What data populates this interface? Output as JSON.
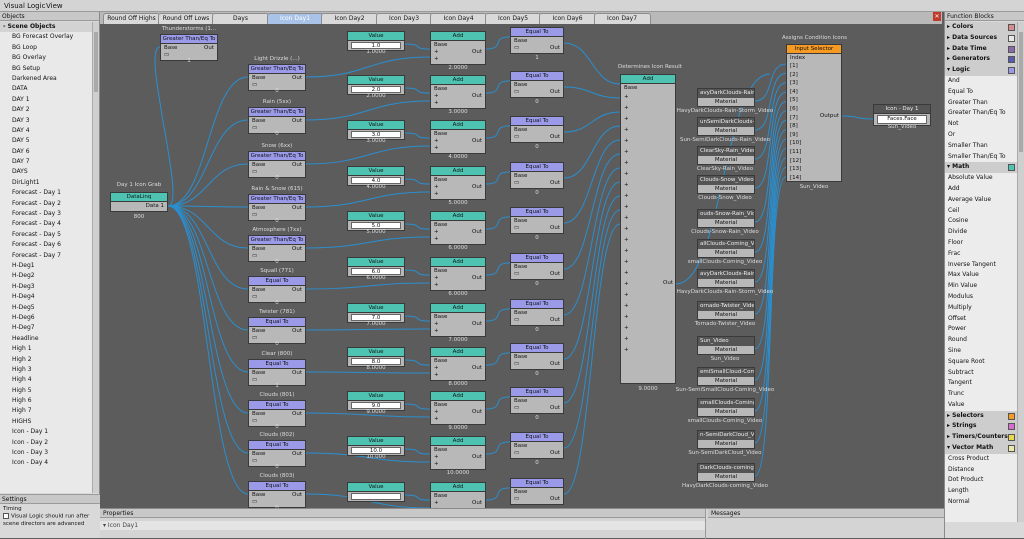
{
  "menu": {
    "title": "Visual Logic",
    "items": [
      "View"
    ]
  },
  "objects_panel": {
    "title": "Objects",
    "category": "- Scene Objects",
    "items": [
      "BG Forecast Overlay",
      "BG Loop",
      "BG Overlay",
      "BG Setup",
      "Darkened Area",
      "DATA",
      "DAY 1",
      "DAY 2",
      "DAY 3",
      "DAY 4",
      "DAY 5",
      "DAY 6",
      "DAY 7",
      "DAYS",
      "DirLight1",
      "Forecast - Day 1",
      "Forecast - Day 2",
      "Forecast - Day 3",
      "Forecast - Day 4",
      "Forecast - Day 5",
      "Forecast - Day 6",
      "Forecast - Day 7",
      "H-Deg1",
      "H-Deg2",
      "H-Deg3",
      "H-Deg4",
      "H-Deg5",
      "H-Deg6",
      "H-Deg7",
      "Headline",
      "High 1",
      "High 2",
      "High 3",
      "High 4",
      "High 5",
      "High 6",
      "High 7",
      "HIGHS",
      "Icon - Day 1",
      "Icon - Day 2",
      "Icon - Day 3",
      "Icon - Day 4"
    ]
  },
  "settings_panel": {
    "title": "Settings",
    "group": "Timing",
    "checkbox_label": "Visual Logic should run after scene directors are advanced"
  },
  "tabs": {
    "items": [
      "Round Off Highs",
      "Round Off Lows",
      "Days",
      "Icon Day1",
      "Icon Day2",
      "Icon Day3",
      "Icon Day4",
      "Icon Day5",
      "Icon Day6",
      "Icon Day7"
    ],
    "active": 3
  },
  "graph": {
    "source": {
      "label": "Day 1 Icon Grab",
      "title": "DataLinq",
      "port": "Data 1",
      "value": "800"
    },
    "gt_nodes": [
      {
        "label": "Thunderstorms (1...",
        "title": "Greater Than/Eq To",
        "value": "1"
      },
      {
        "label": "Light Drizzle (...)",
        "title": "Greater Than/Eq To",
        "value": "0"
      },
      {
        "label": "Rain (5xx)",
        "title": "Greater Than/Eq To",
        "value": "0"
      },
      {
        "label": "Snow (6xx)",
        "title": "Greater Than/Eq To",
        "value": "0"
      },
      {
        "label": "Rain & Snow (615)",
        "title": "Greater Than/Eq To",
        "value": "0"
      },
      {
        "label": "Atmosphere (7xx)",
        "title": "Greater Than/Eq To",
        "value": "0"
      }
    ],
    "eq_nodes": [
      {
        "label": "Squall (771)",
        "title": "Equal To",
        "value": "0"
      },
      {
        "label": "Twister (781)",
        "title": "Equal To",
        "value": "0"
      },
      {
        "label": "Clear (800)",
        "title": "Equal To",
        "value": "1"
      },
      {
        "label": "Clouds (801)",
        "title": "Equal To",
        "value": "0"
      },
      {
        "label": "Clouds (802)",
        "title": "Equal To",
        "value": "0"
      },
      {
        "label": "Clouds (803)",
        "title": "Equal To",
        "value": "0"
      }
    ],
    "values": [
      {
        "title": "Value",
        "field": "1.0",
        "out": "1.0000"
      },
      {
        "title": "Value",
        "field": "2.0",
        "out": "2.0000"
      },
      {
        "title": "Value",
        "field": "3.0",
        "out": "3.0000"
      },
      {
        "title": "Value",
        "field": "4.0",
        "out": "4.0000"
      },
      {
        "title": "Value",
        "field": "5.0",
        "out": "5.0000"
      },
      {
        "title": "Value",
        "field": "6.0",
        "out": "6.0000"
      },
      {
        "title": "Value",
        "field": "7.0",
        "out": "7.0000"
      },
      {
        "title": "Value",
        "field": "8.0",
        "out": "8.0000"
      },
      {
        "title": "Value",
        "field": "9.0",
        "out": "9.0000"
      },
      {
        "title": "Value",
        "field": "10.0",
        "out": "10.000"
      },
      {
        "title": "Value",
        "field": "",
        "out": ""
      }
    ],
    "adds": [
      {
        "title": "Add",
        "out": "2.0000"
      },
      {
        "title": "Add",
        "out": "3.0000"
      },
      {
        "title": "Add",
        "out": "4.0000"
      },
      {
        "title": "Add",
        "out": "5.0000"
      },
      {
        "title": "Add",
        "out": "6.0000"
      },
      {
        "title": "Add",
        "out": "6.0000"
      },
      {
        "title": "Add",
        "out": "7.0000"
      },
      {
        "title": "Add",
        "out": "8.0000"
      },
      {
        "title": "Add",
        "out": "9.0000"
      },
      {
        "title": "Add",
        "out": "10.0000"
      },
      {
        "title": "Add",
        "out": ""
      }
    ],
    "eq2": [
      {
        "title": "Equal To",
        "value": "1"
      },
      {
        "title": "Equal To",
        "value": "0"
      },
      {
        "title": "Equal To",
        "value": "0"
      },
      {
        "title": "Equal To",
        "value": "0"
      },
      {
        "title": "Equal To",
        "value": "0"
      },
      {
        "title": "Equal To",
        "value": "0"
      },
      {
        "title": "Equal To",
        "value": "0"
      },
      {
        "title": "Equal To",
        "value": "0"
      },
      {
        "title": "Equal To",
        "value": "0"
      },
      {
        "title": "Equal To",
        "value": "0"
      },
      {
        "title": "Equal To",
        "value": ""
      }
    ],
    "big_add": {
      "label": "Determines Icon Result",
      "title": "Add",
      "port_base": "Base",
      "port_out": "Out",
      "value": "9.0000"
    },
    "materials": [
      {
        "name": "avyDarkClouds-Rain-Storm",
        "type": "Material",
        "caption": "HavyDarkClouds-Rain-Storm_Video"
      },
      {
        "name": "unSemiDarkClouds-Rain",
        "type": "Material",
        "caption": "Sun-SemiDarkClouds-Rain_Video"
      },
      {
        "name": "ClearSky-Rain_Video",
        "type": "Material",
        "caption": "ClearSky-Rain_Video"
      },
      {
        "name": "Clouds-Snow_Video",
        "type": "Material",
        "caption": "Clouds-Snow_Video"
      },
      {
        "name": "ouds-Snow-Rain_Vide",
        "type": "Material",
        "caption": "Clouds-Snow-Rain_Video"
      },
      {
        "name": "allClouds-Coming_Vid",
        "type": "Material",
        "caption": "smallClouds-Coming_Video"
      },
      {
        "name": "avyDarkClouds-Rain-Storm",
        "type": "Material",
        "caption": "HavyDarkClouds-Rain-Storm_Video"
      },
      {
        "name": "ornado-Twister_Vide",
        "type": "Material",
        "caption": "Tornado-Twister_Video"
      },
      {
        "name": "Sun_Video",
        "type": "Material",
        "caption": "Sun_Video"
      },
      {
        "name": "emiSmallCloud-Coming",
        "type": "Material",
        "caption": "Sun-SemiSmallCloud-Coming_Video"
      },
      {
        "name": "smallClouds-Coming_",
        "type": "Material",
        "caption": "smallClouds-Coming_Video"
      },
      {
        "name": "n-SemiDarkCloud_Vid",
        "type": "Material",
        "caption": "Sun-SemiDarkCloud_Video"
      },
      {
        "name": "DarkClouds-coming_V",
        "type": "Material",
        "caption": "HavyDarkClouds-coming_Video"
      }
    ],
    "selector": {
      "label": "Assigns Condition Icons",
      "title": "Input Selector",
      "index_label": "Index",
      "inputs": [
        "[1]",
        "[2]",
        "[3]",
        "[4]",
        "[5]",
        "[6]",
        "[7]",
        "[8]",
        "[9]",
        "[10]",
        "[11]",
        "[12]",
        "[13]",
        "[14]"
      ],
      "out": "Output",
      "caption": "Sun_Video"
    },
    "target": {
      "title": "Icon - Day 1",
      "port": "Faces.Face",
      "caption": "Sun_Video"
    }
  },
  "functions_panel": {
    "title": "Function Blocks",
    "categories": [
      {
        "name": "Colors",
        "expanded": false,
        "color": "#d98a8a"
      },
      {
        "name": "Data Sources",
        "expanded": false,
        "color": "#e8e8e8"
      },
      {
        "name": "Date Time",
        "expanded": false,
        "color": "#8a6aa8"
      },
      {
        "name": "Generators",
        "expanded": false,
        "color": "#5a5ab0"
      },
      {
        "name": "Logic",
        "expanded": true,
        "color": "#9a9ae8",
        "items": [
          "And",
          "Equal To",
          "Greater Than",
          "Greater Than/Eq To",
          "Not",
          "Or",
          "Smaller Than",
          "Smaller Than/Eq To"
        ]
      },
      {
        "name": "Math",
        "expanded": true,
        "color": "#4ec3b2",
        "items": [
          "Absolute Value",
          "Add",
          "Average Value",
          "Ceil",
          "Cosine",
          "Divide",
          "Floor",
          "Frac",
          "Inverse Tangent",
          "Max Value",
          "Min Value",
          "Modulus",
          "Multiply",
          "Offset",
          "Power",
          "Round",
          "Sine",
          "Square Root",
          "Subtract",
          "Tangent",
          "Trunc",
          "Value"
        ]
      },
      {
        "name": "Selectors",
        "expanded": false,
        "color": "#f59a23"
      },
      {
        "name": "Strings",
        "expanded": false,
        "color": "#d86ad0"
      },
      {
        "name": "Timers/Counters",
        "expanded": false,
        "color": "#e8d84a"
      },
      {
        "name": "Vector Math",
        "expanded": true,
        "color": "#e8e8a8",
        "items": [
          "Cross Product",
          "Distance",
          "Dot Product",
          "Length",
          "Normal"
        ]
      }
    ]
  },
  "properties_panel": {
    "title": "Properties",
    "row": "Icon Day1"
  },
  "messages_panel": {
    "title": "Messages"
  }
}
